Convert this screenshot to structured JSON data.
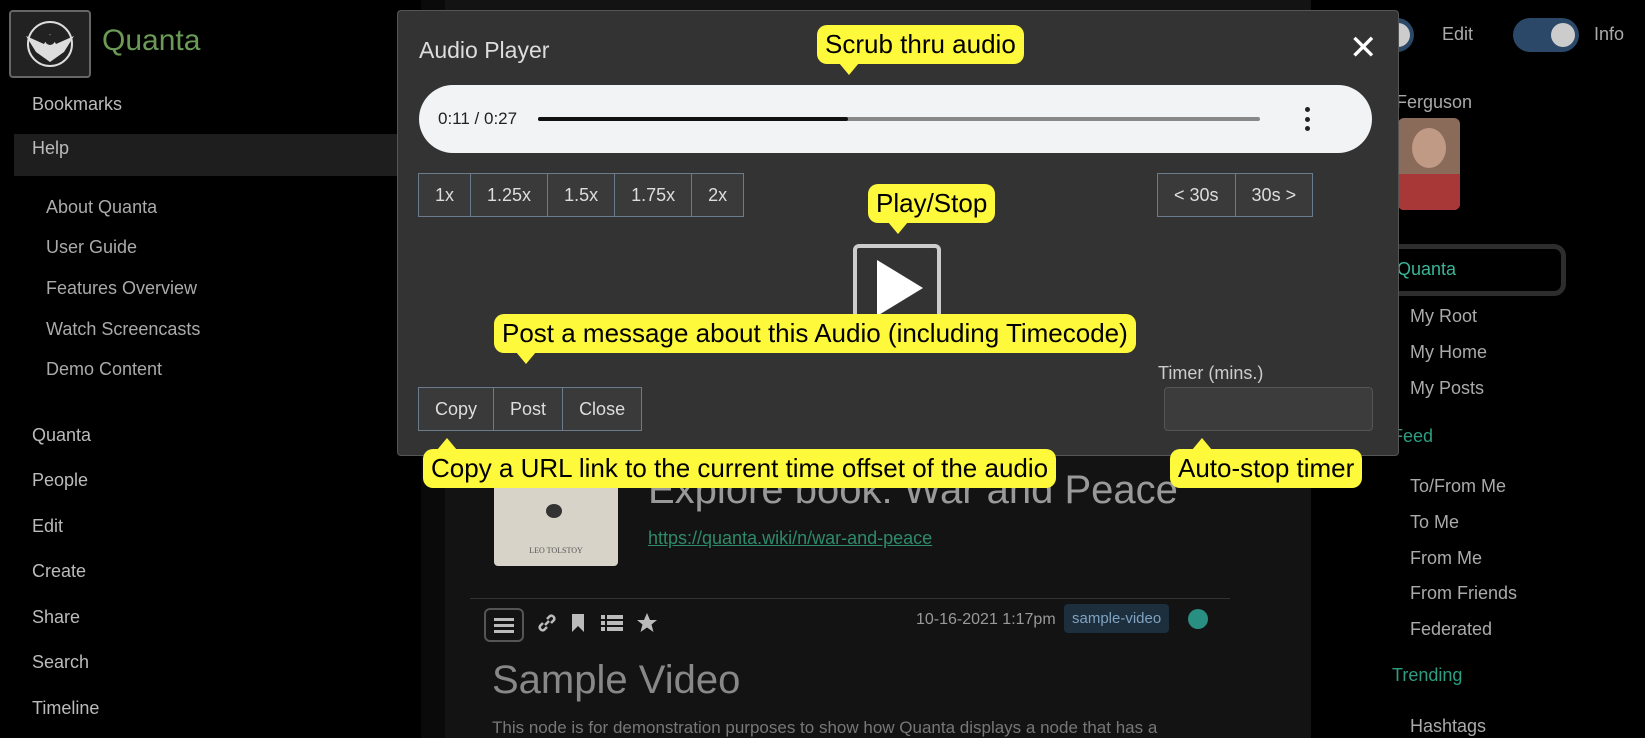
{
  "app": {
    "title": "Quanta"
  },
  "sidebar": {
    "items": [
      {
        "label": "Bookmarks"
      },
      {
        "label": "Help"
      },
      {
        "label": "Quanta"
      },
      {
        "label": "People"
      },
      {
        "label": "Edit"
      },
      {
        "label": "Create"
      },
      {
        "label": "Share"
      },
      {
        "label": "Search"
      },
      {
        "label": "Timeline"
      }
    ],
    "help_items": [
      {
        "label": "About Quanta"
      },
      {
        "label": "User Guide"
      },
      {
        "label": "Features Overview"
      },
      {
        "label": "Watch Screencasts"
      },
      {
        "label": "Demo Content"
      }
    ]
  },
  "background": {
    "node_title": "Explore book: War and Peace",
    "node_link": "https://quanta.wiki/n/war-and-peace",
    "book_cover_text": "LEO TOLSTOY",
    "node_date": "10-16-2021 1:17pm",
    "node_tag": "sample-video",
    "node2_title": "Sample Video",
    "node2_text": "This node is for demonstration purposes to show how Quanta displays a node that has a"
  },
  "right_panel": {
    "edit_label": "Edit",
    "info_label": "Info",
    "username": "Ferguson",
    "quanta_label": "Quanta",
    "root_items": [
      {
        "label": "My Root"
      },
      {
        "label": "My Home"
      },
      {
        "label": "My Posts"
      }
    ],
    "feed_label": "Feed",
    "feed_items": [
      {
        "label": "To/From Me"
      },
      {
        "label": "To Me"
      },
      {
        "label": "From Me"
      },
      {
        "label": "From Friends"
      },
      {
        "label": "Federated"
      }
    ],
    "trending_label": "Trending",
    "trending_items": [
      {
        "label": "Hashtags"
      }
    ]
  },
  "modal": {
    "title": "Audio Player",
    "close_icon": "✕",
    "audio": {
      "time": "0:11 / 0:27",
      "progress": 0.43
    },
    "speed_buttons": [
      {
        "label": "1x"
      },
      {
        "label": "1.25x"
      },
      {
        "label": "1.5x"
      },
      {
        "label": "1.75x"
      },
      {
        "label": "2x"
      }
    ],
    "skip_buttons": [
      {
        "label": "< 30s"
      },
      {
        "label": "30s >"
      }
    ],
    "action_buttons": [
      {
        "label": "Copy"
      },
      {
        "label": "Post"
      },
      {
        "label": "Close"
      }
    ],
    "timer_label": "Timer (mins.)",
    "timer_value": ""
  },
  "callouts": {
    "scrub": "Scrub thru audio",
    "play": "Play/Stop",
    "post": "Post a message about this Audio (including Timecode)",
    "copy": "Copy a URL link to the current time offset of the audio",
    "timer": "Auto-stop timer"
  },
  "colors": {
    "callout": "#fff93b",
    "accent_green": "#6a9a56",
    "link_teal": "#2e8b6a"
  }
}
